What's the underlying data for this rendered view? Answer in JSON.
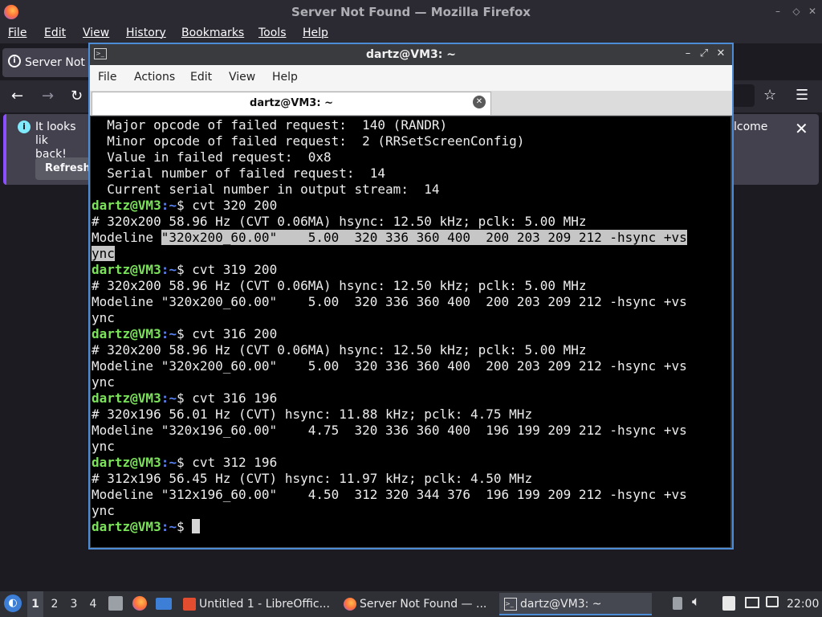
{
  "firefox": {
    "title": "Server Not Found — Mozilla Firefox",
    "menu": [
      "File",
      "Edit",
      "View",
      "History",
      "Bookmarks",
      "Tools",
      "Help"
    ],
    "tab_title": "Server Not F",
    "notice_text": "It looks lik back!",
    "notice_text_line1": "It looks lik",
    "notice_text_line2": "back!",
    "notice_right": "lcome",
    "refresh_label": "Refresh"
  },
  "terminal": {
    "title": "dartz@VM3: ~",
    "menu": [
      "File",
      "Actions",
      "Edit",
      "View",
      "Help"
    ],
    "tab_title": "dartz@VM3: ~",
    "prompt_user": "dartz@VM3",
    "prompt_path": ":~",
    "prompt_symbol": "$ ",
    "lines": [
      {
        "kind": "out",
        "text": "  Major opcode of failed request:  140 (RANDR)"
      },
      {
        "kind": "out",
        "text": "  Minor opcode of failed request:  2 (RRSetScreenConfig)"
      },
      {
        "kind": "out",
        "text": "  Value in failed request:  0x8"
      },
      {
        "kind": "out",
        "text": "  Serial number of failed request:  14"
      },
      {
        "kind": "out",
        "text": "  Current serial number in output stream:  14"
      },
      {
        "kind": "cmd",
        "text": "cvt 320 200"
      },
      {
        "kind": "out",
        "text": "# 320x200 58.96 Hz (CVT 0.06MA) hsync: 12.50 kHz; pclk: 5.00 MHz"
      },
      {
        "kind": "sel1",
        "pre": "Modeline ",
        "text": "\"320x200_60.00\"    5.00  320 336 360 400  200 203 209 212 -hsync +vs"
      },
      {
        "kind": "sel2",
        "text": "ync"
      },
      {
        "kind": "cmd",
        "text": "cvt 319 200"
      },
      {
        "kind": "out",
        "text": "# 320x200 58.96 Hz (CVT 0.06MA) hsync: 12.50 kHz; pclk: 5.00 MHz"
      },
      {
        "kind": "out",
        "text": "Modeline \"320x200_60.00\"    5.00  320 336 360 400  200 203 209 212 -hsync +vs"
      },
      {
        "kind": "out",
        "text": "ync"
      },
      {
        "kind": "cmd",
        "text": "cvt 316 200"
      },
      {
        "kind": "out",
        "text": "# 320x200 58.96 Hz (CVT 0.06MA) hsync: 12.50 kHz; pclk: 5.00 MHz"
      },
      {
        "kind": "out",
        "text": "Modeline \"320x200_60.00\"    5.00  320 336 360 400  200 203 209 212 -hsync +vs"
      },
      {
        "kind": "out",
        "text": "ync"
      },
      {
        "kind": "cmd",
        "text": "cvt 316 196"
      },
      {
        "kind": "out",
        "text": "# 320x196 56.01 Hz (CVT) hsync: 11.88 kHz; pclk: 4.75 MHz"
      },
      {
        "kind": "out",
        "text": "Modeline \"320x196_60.00\"    4.75  320 336 360 400  196 199 209 212 -hsync +vs"
      },
      {
        "kind": "out",
        "text": "ync"
      },
      {
        "kind": "cmd",
        "text": "cvt 312 196"
      },
      {
        "kind": "out",
        "text": "# 312x196 56.45 Hz (CVT) hsync: 11.97 kHz; pclk: 4.50 MHz"
      },
      {
        "kind": "out",
        "text": "Modeline \"312x196_60.00\"    4.50  312 320 344 376  196 199 209 212 -hsync +vs"
      },
      {
        "kind": "out",
        "text": "ync"
      },
      {
        "kind": "prompt",
        "text": ""
      }
    ]
  },
  "taskbar": {
    "workspaces": [
      "1",
      "2",
      "3",
      "4"
    ],
    "active_workspace": "1",
    "tasks": [
      {
        "label": "Untitled 1 - LibreOffic...",
        "icon": "libreoffice-writer-icon"
      },
      {
        "label": "Server Not Found — ...",
        "icon": "firefox-icon"
      },
      {
        "label": "dartz@VM3: ~",
        "icon": "terminal-icon"
      }
    ],
    "clock": "22:00"
  }
}
